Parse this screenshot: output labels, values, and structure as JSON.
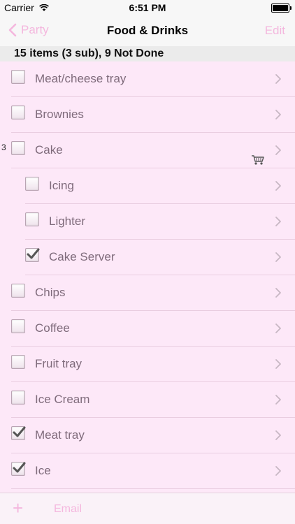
{
  "status": {
    "carrier": "Carrier",
    "time": "6:51 PM"
  },
  "nav": {
    "back_label": "Party",
    "title": "Food & Drinks",
    "edit_label": "Edit"
  },
  "summary": "15 items (3 sub), 9 Not Done",
  "items": [
    {
      "label": "Meat/cheese tray",
      "checked": false,
      "indent": 0
    },
    {
      "label": "Brownies",
      "checked": false,
      "indent": 0
    },
    {
      "label": "Cake",
      "checked": false,
      "indent": 0,
      "count": "3",
      "cart": true
    },
    {
      "label": "Icing",
      "checked": false,
      "indent": 1
    },
    {
      "label": "Lighter",
      "checked": false,
      "indent": 1
    },
    {
      "label": "Cake Server",
      "checked": true,
      "indent": 1
    },
    {
      "label": "Chips",
      "checked": false,
      "indent": 0
    },
    {
      "label": "Coffee",
      "checked": false,
      "indent": 0
    },
    {
      "label": "Fruit tray",
      "checked": false,
      "indent": 0
    },
    {
      "label": "Ice Cream",
      "checked": false,
      "indent": 0
    },
    {
      "label": "Meat tray",
      "checked": true,
      "indent": 0
    },
    {
      "label": "Ice",
      "checked": true,
      "indent": 0
    }
  ],
  "toolbar": {
    "add_label": "+",
    "email_label": "Email"
  },
  "colors": {
    "accent": "#f4b7de",
    "row_background": "#fde8f8",
    "label_text": "#7f6b7b"
  }
}
